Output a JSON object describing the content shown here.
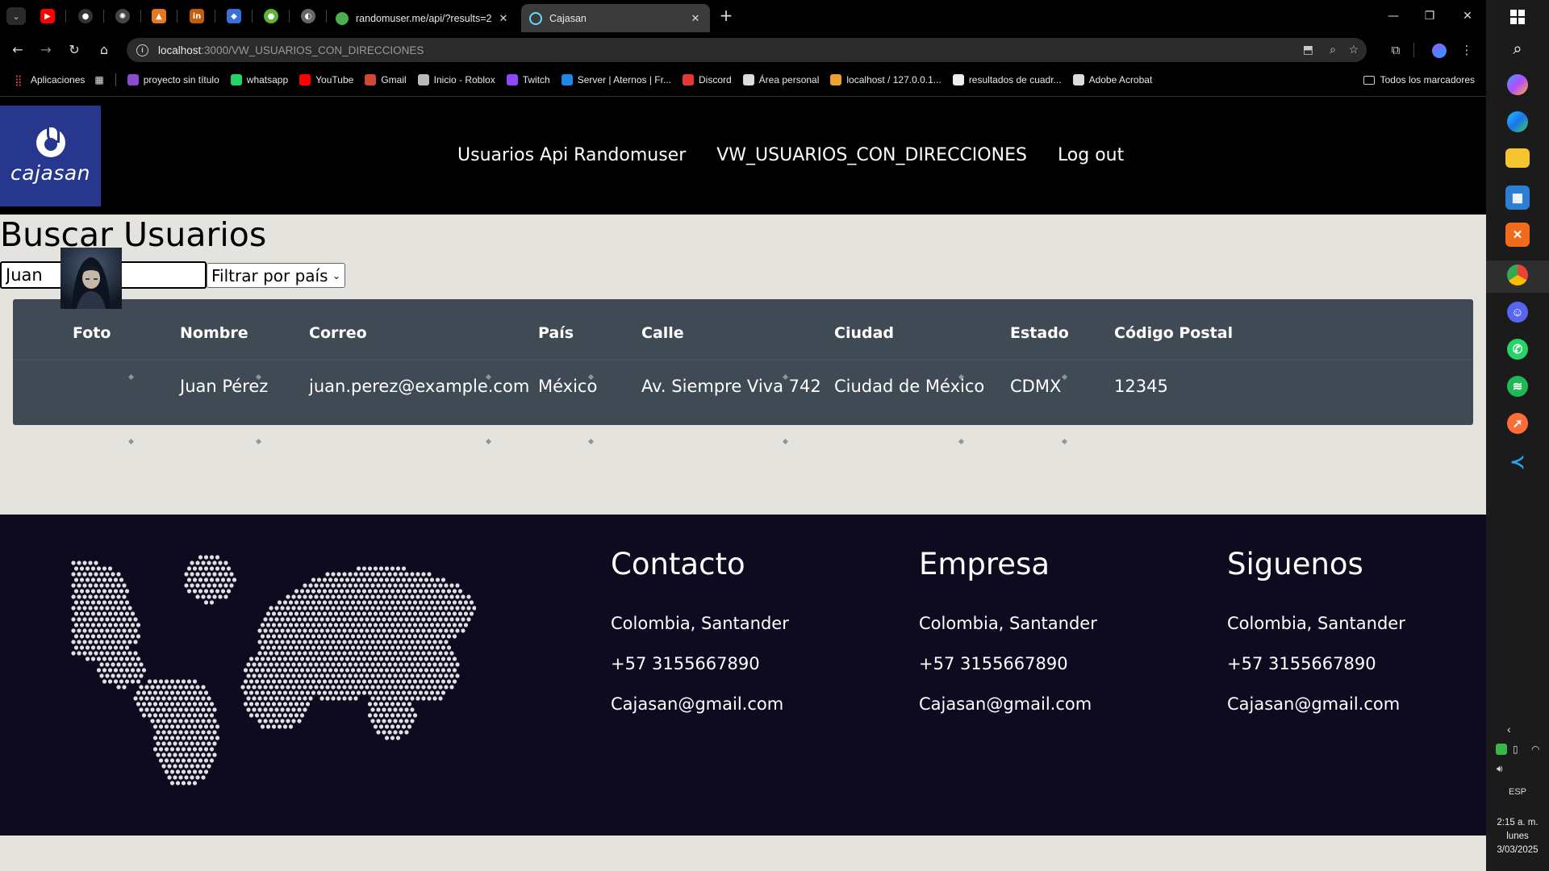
{
  "browser": {
    "tabs": [
      {
        "title": "randomuser.me/api/?results=2",
        "close": "✕",
        "favicon_color": "#4cae4c"
      },
      {
        "title": "Cajasan",
        "close": "✕",
        "favicon_color": "#61dafb"
      }
    ],
    "pinned_tabs": [
      {
        "name": "youtube-pinned",
        "color": "#ff0000"
      },
      {
        "name": "github-pinned",
        "color": "#444"
      },
      {
        "name": "openai-pinned",
        "color": "#555"
      },
      {
        "name": "tab-orange-pinned",
        "color": "#e8771c"
      },
      {
        "name": "in-pinned",
        "color": "#c45d0a"
      },
      {
        "name": "medal-pinned",
        "color": "#3a6fd8"
      },
      {
        "name": "green-pinned",
        "color": "#5fb33a"
      },
      {
        "name": "grey-pinned",
        "color": "#777"
      }
    ],
    "new_tab": "+",
    "window_controls": {
      "minimize": "—",
      "restore": "❐",
      "close": "✕"
    },
    "nav": {
      "back": "←",
      "forward": "→",
      "reload": "↻",
      "home": "⌂"
    },
    "url": {
      "host": "localhost",
      "path": ":3000/VW_USUARIOS_CON_DIRECCIONES"
    },
    "bookmarks": [
      {
        "label": "Aplicaciones",
        "color": "#e84b3c"
      },
      {
        "label": "proyecto sin título",
        "color": "#8a4ccf"
      },
      {
        "label": "whatsapp",
        "color": "#25d366"
      },
      {
        "label": "YouTube",
        "color": "#ff0000"
      },
      {
        "label": "Gmail",
        "color": "#d14836"
      },
      {
        "label": "Inicio - Roblox",
        "color": "#bbbbbb"
      },
      {
        "label": "Twitch",
        "color": "#9146ff"
      },
      {
        "label": "Server | Aternos | Fr...",
        "color": "#1e88e5"
      },
      {
        "label": "Discord",
        "color": "#e53935"
      },
      {
        "label": "Área personal",
        "color": "#dddddd"
      },
      {
        "label": "localhost / 127.0.0.1...",
        "color": "#f0a030"
      },
      {
        "label": "resultados de cuadr...",
        "color": "#eeeeee"
      },
      {
        "label": "Adobe Acrobat",
        "color": "#dddddd"
      }
    ],
    "all_bookmarks": "Todos los marcadores"
  },
  "site": {
    "logo_text": "cajasan",
    "nav": [
      "Usuarios Api Randomuser",
      "VW_USUARIOS_CON_DIRECCIONES",
      "Log out"
    ]
  },
  "search": {
    "title": "Buscar Usuarios",
    "query": "Juan",
    "country_filter": "Filtrar por país"
  },
  "table": {
    "headers": [
      "Foto",
      "Nombre",
      "Correo",
      "País",
      "Calle",
      "Ciudad",
      "Estado",
      "Código Postal"
    ],
    "rows": [
      {
        "nombre": "Juan Pérez",
        "correo": "juan.perez@example.com",
        "pais": "México",
        "calle": "Av. Siempre Viva 742",
        "ciudad": "Ciudad de México",
        "estado": "CDMX",
        "codigo_postal": "12345"
      }
    ]
  },
  "footer": {
    "columns": [
      {
        "title": "Contacto",
        "lines": [
          "Colombia, Santander",
          "+57 3155667890",
          "Cajasan@gmail.com"
        ]
      },
      {
        "title": "Empresa",
        "lines": [
          "Colombia, Santander",
          "+57 3155667890",
          "Cajasan@gmail.com"
        ]
      },
      {
        "title": "Siguenos",
        "lines": [
          "Colombia, Santander",
          "+57 3155667890",
          "Cajasan@gmail.com"
        ]
      }
    ]
  },
  "taskbar": {
    "language": "ESP",
    "time": "2:15 a. m.",
    "day": "lunes",
    "date": "3/03/2025"
  },
  "colors": {
    "header_bg": "#000000",
    "logo_bg": "#26378d",
    "page_bg": "#e4e3de",
    "table_bg": "#404a54",
    "footer_bg": "#0e0b21"
  }
}
